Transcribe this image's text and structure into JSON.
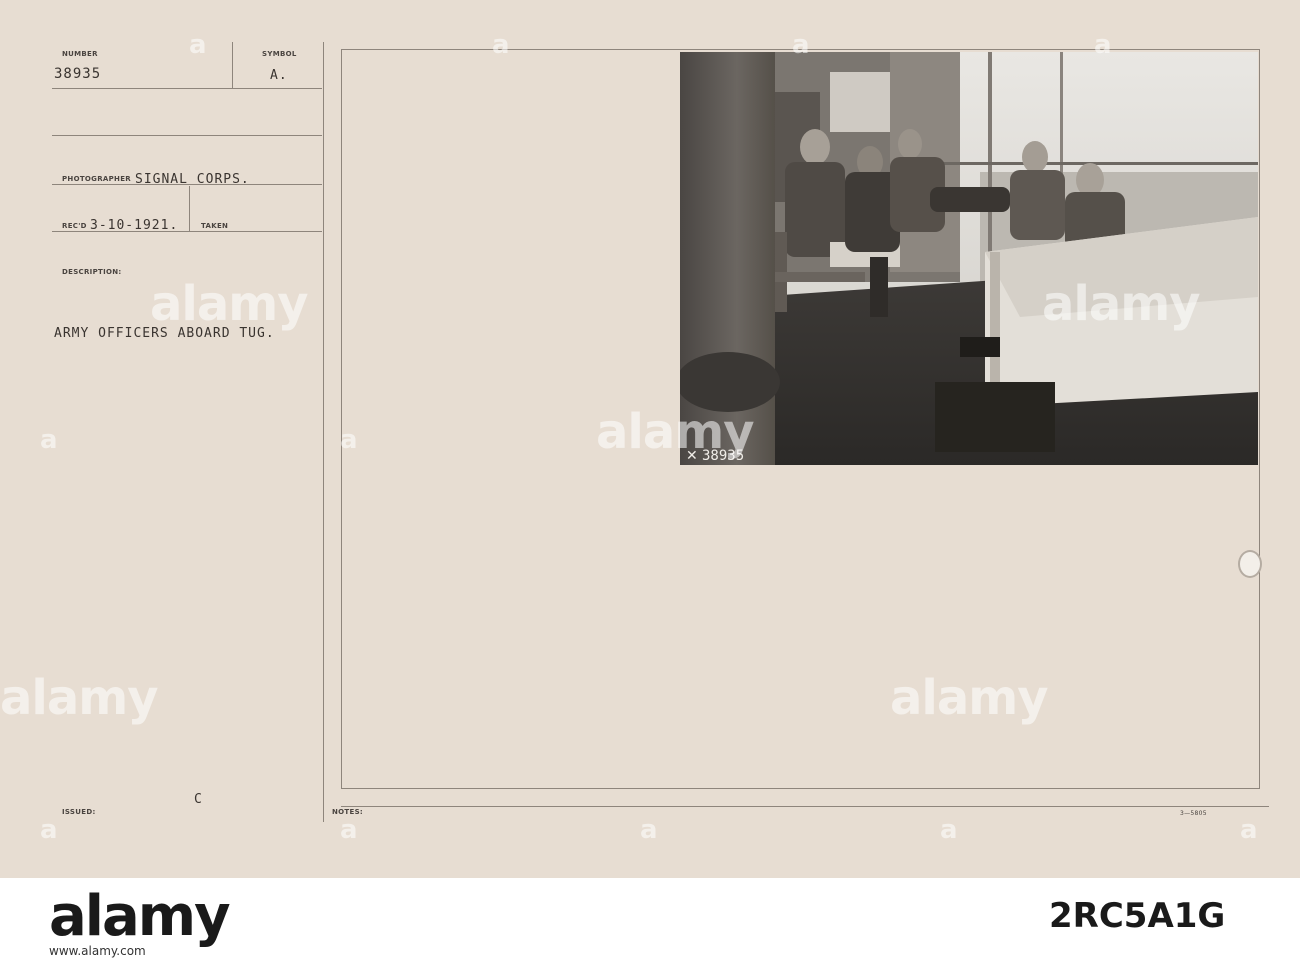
{
  "card": {
    "number_label": "NUMBER",
    "number_value": "38935",
    "symbol_label": "SYMBOL",
    "symbol_value": "A.",
    "photographer_label": "PHOTOGRAPHER",
    "photographer_value": "SIGNAL CORPS.",
    "recd_label": "REC'D",
    "recd_value": "3-10-1921.",
    "taken_label": "TAKEN",
    "description_label": "DESCRIPTION:",
    "description_value": "ARMY OFFICERS ABOARD TUG.",
    "issued_label": "ISSUED:",
    "issued_value": "C",
    "notes_label": "NOTES:",
    "form_code": "3—5805"
  },
  "photo": {
    "caption_number": "38935",
    "caption_mark_icon": "crossed-flags-icon",
    "subject": "officers-seated-on-tug-deck"
  },
  "watermark": {
    "text": "alamy",
    "mark": "a"
  },
  "footer": {
    "logo": "alamy",
    "image_id": "2RC5A1G",
    "meta": "www.alamy.com"
  }
}
